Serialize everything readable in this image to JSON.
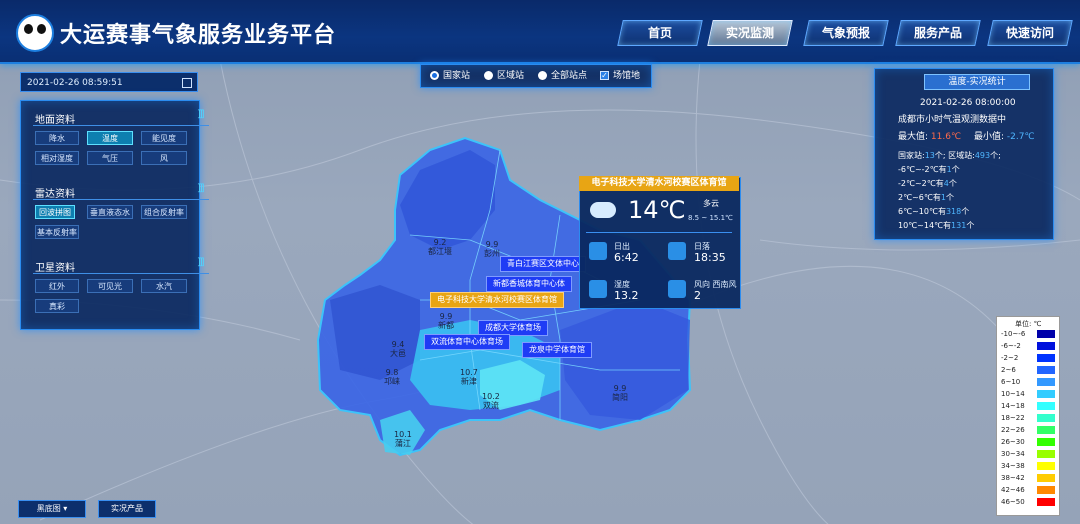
{
  "app": {
    "title": "大运赛事气象服务业务平台"
  },
  "nav": [
    {
      "label": "首页",
      "active": false
    },
    {
      "label": "实况监测",
      "active": true
    },
    {
      "label": "气象预报",
      "active": false
    },
    {
      "label": "服务产品",
      "active": false
    },
    {
      "label": "快速访问",
      "active": false
    }
  ],
  "datetime": {
    "value": "2021-02-26 08:59:51"
  },
  "left_panel": {
    "surface": {
      "title": "地面资料",
      "items": [
        "降水",
        "温度",
        "能见度",
        "相对湿度",
        "气压",
        "风"
      ],
      "active": "温度"
    },
    "radar": {
      "title": "雷达资料",
      "items": [
        "回波拼图",
        "垂直液态水",
        "组合反射率",
        "基本反射率"
      ],
      "active": "回波拼图"
    },
    "satellite": {
      "title": "卫星资料",
      "items": [
        "红外",
        "可见光",
        "水汽",
        "真彩"
      ]
    }
  },
  "station_filter": {
    "options": [
      "国家站",
      "区域站",
      "全部站点",
      "场馆地"
    ],
    "selected": "国家站",
    "checked": "场馆地"
  },
  "stats": {
    "title": "温度-实况统计",
    "time": "2021-02-26 08:00:00",
    "subtitle": "成都市小时气温观测数据中",
    "max_label": "最大值:",
    "max_value": "11.6℃",
    "min_label": "最小值:",
    "min_value": "-2.7℃",
    "counts_national_label": "国家站:",
    "counts_national": "13",
    "counts_unit1": "个;",
    "counts_regional_label": "区域站:",
    "counts_regional": "493",
    "counts_unit2": "个;",
    "ranges": [
      {
        "label": "-6℃~-2℃有",
        "count": "1",
        "unit": "个"
      },
      {
        "label": "-2℃~2℃有",
        "count": "4",
        "unit": "个"
      },
      {
        "label": "2℃~6℃有",
        "count": "1",
        "unit": "个"
      },
      {
        "label": "6℃~10℃有",
        "count": "318",
        "unit": "个"
      },
      {
        "label": "10℃~14℃有",
        "count": "131",
        "unit": "个"
      }
    ]
  },
  "popup": {
    "venue": "电子科技大学清水河校赛区体育馆",
    "temp": "14℃",
    "weather": "多云",
    "range": "8.5 ~ 15.1℃",
    "sunrise_label": "日出",
    "sunrise": "6:42",
    "sunset_label": "日落",
    "sunset": "18:35",
    "humidity_label": "湿度",
    "humidity": "13.2",
    "wind_label": "风向 西南风",
    "wind": "2"
  },
  "venue_labels": [
    "青白江赛区文体中心",
    "新都香城体育中心体",
    "电子科技大学清水河校赛区体育馆",
    "成都大学体育场",
    "双流体育中心体育场",
    "龙泉中学体育馆"
  ],
  "stations": [
    {
      "value": "9.2",
      "name": "都江堰"
    },
    {
      "value": "9.9",
      "name": "彭州"
    },
    {
      "value": "9.9",
      "name": "新都"
    },
    {
      "value": "9.4",
      "name": "大邑"
    },
    {
      "value": "9.8",
      "name": "邛崃"
    },
    {
      "value": "10.7",
      "name": "新津"
    },
    {
      "value": "10.2",
      "name": "双流"
    },
    {
      "value": "9.9",
      "name": "简阳"
    },
    {
      "value": "10.1",
      "name": "蒲江"
    }
  ],
  "legend": {
    "unit": "单位: ℃",
    "rows": [
      {
        "label": "-10~-6",
        "color": "#0000aa"
      },
      {
        "label": "-6~-2",
        "color": "#0011dd"
      },
      {
        "label": "-2~2",
        "color": "#0033ff"
      },
      {
        "label": "2~6",
        "color": "#2266ff"
      },
      {
        "label": "6~10",
        "color": "#3399ff"
      },
      {
        "label": "10~14",
        "color": "#33ccff"
      },
      {
        "label": "14~18",
        "color": "#33ffff"
      },
      {
        "label": "18~22",
        "color": "#33ffcc"
      },
      {
        "label": "22~26",
        "color": "#33ff66"
      },
      {
        "label": "26~30",
        "color": "#33ff00"
      },
      {
        "label": "30~34",
        "color": "#99ff00"
      },
      {
        "label": "34~38",
        "color": "#ffff00"
      },
      {
        "label": "38~42",
        "color": "#ffcc00"
      },
      {
        "label": "42~46",
        "color": "#ff8800"
      },
      {
        "label": "46~50",
        "color": "#ff0000"
      }
    ]
  },
  "bottom": {
    "basemap": "黑底图",
    "product": "实况产品"
  }
}
